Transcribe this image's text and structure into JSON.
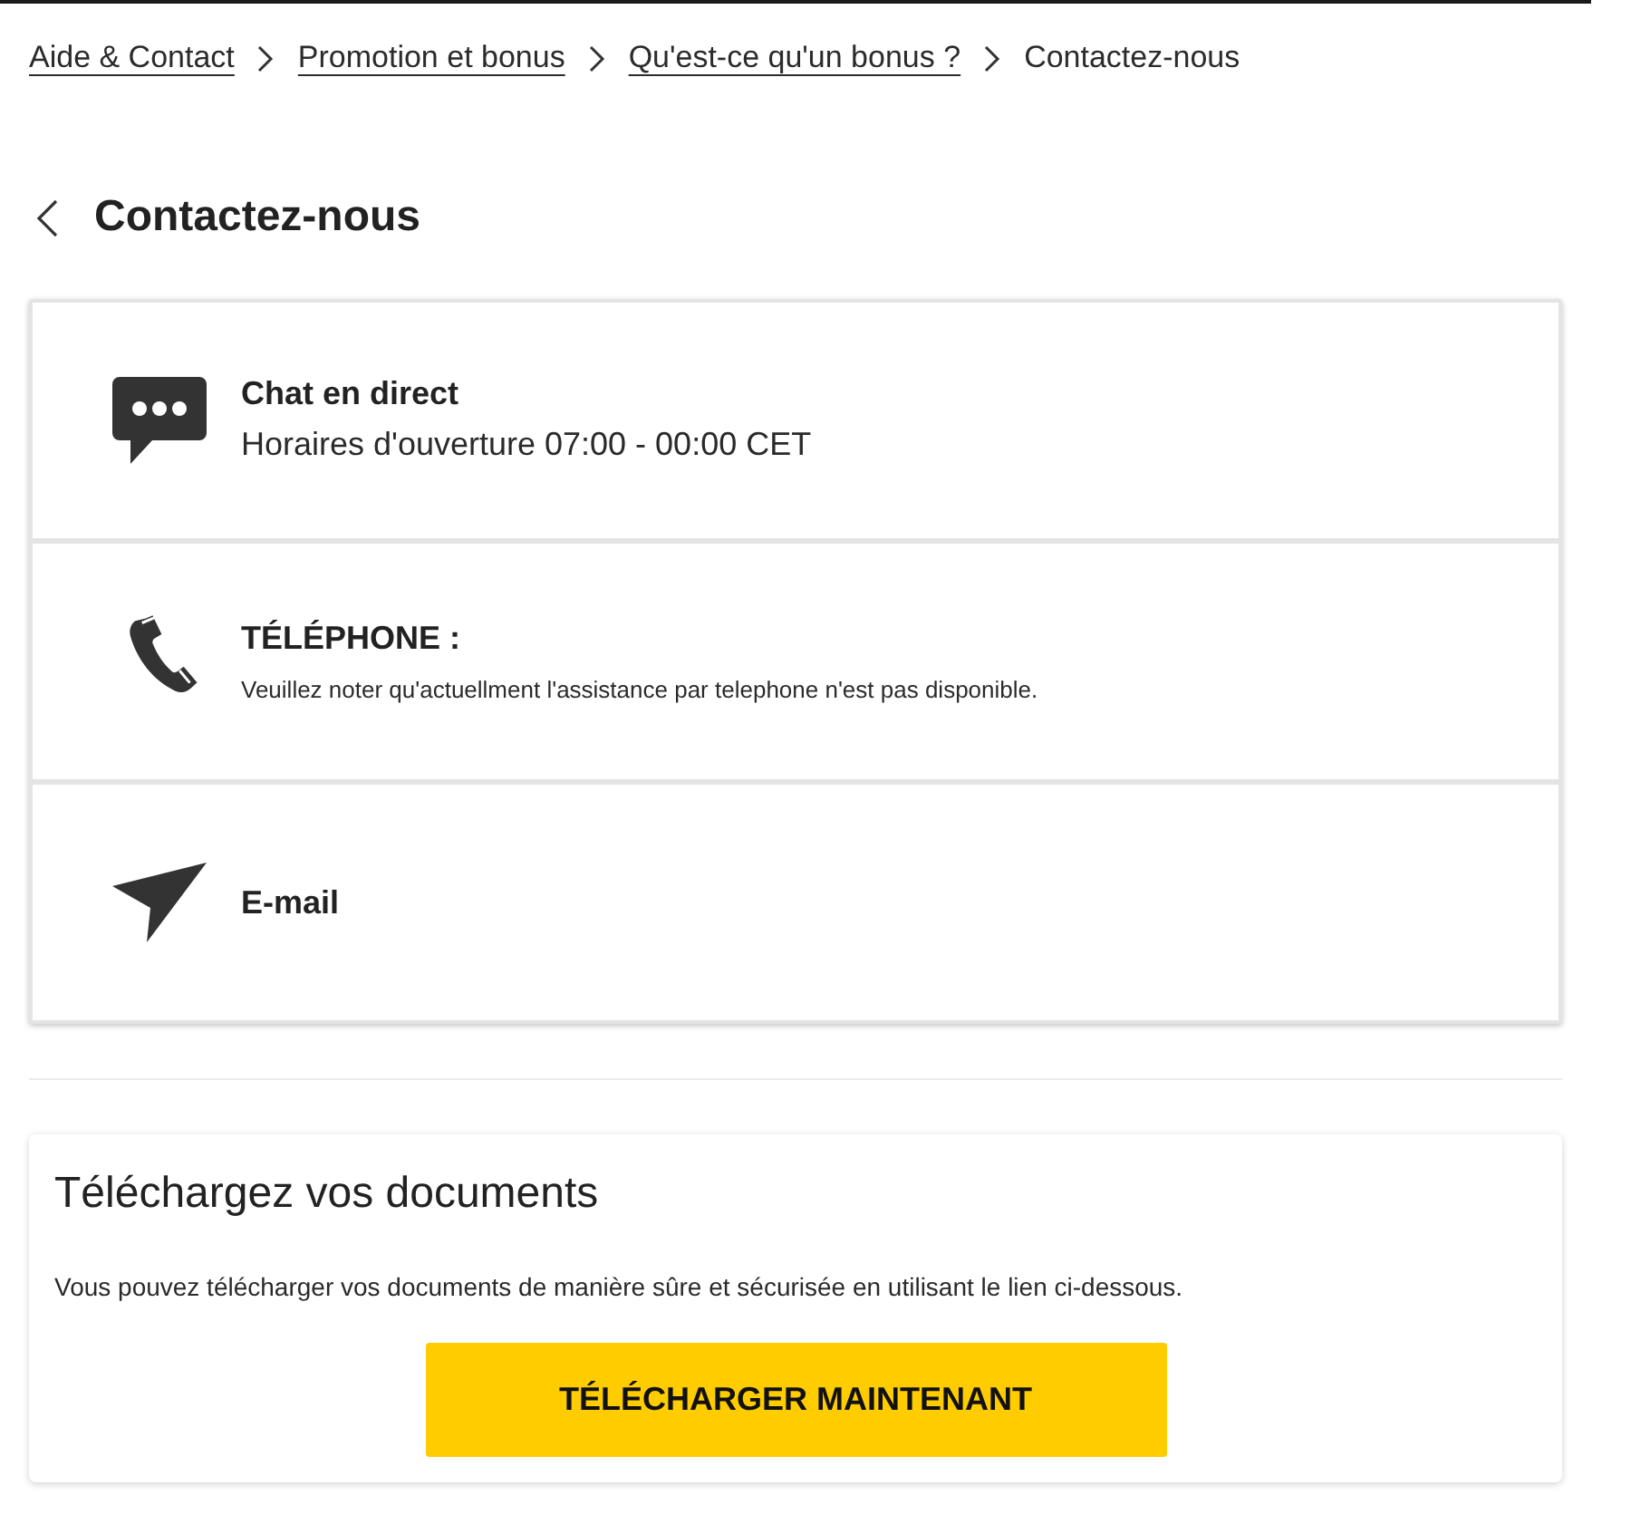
{
  "breadcrumb": [
    {
      "label": "Aide & Contact",
      "current": false
    },
    {
      "label": "Promotion et bonus",
      "current": false
    },
    {
      "label": "Qu'est-ce qu'un bonus ?",
      "current": false
    },
    {
      "label": "Contactez-nous",
      "current": true
    }
  ],
  "page_title": "Contactez-nous",
  "contact_options": [
    {
      "kind": "chat",
      "title": "Chat en direct",
      "detail": "Horaires d'ouverture 07:00 - 00:00 CET"
    },
    {
      "kind": "phone",
      "title": "TÉLÉPHONE :",
      "note": "Veuillez noter qu'actuellment l'assistance par telephone n'est pas disponible."
    },
    {
      "kind": "email",
      "title": "E-mail"
    }
  ],
  "upload": {
    "title": "Téléchargez vos documents",
    "text": "Vous pouvez télécharger vos documents de manière sûre et sécurisée en utilisant le lien ci-dessous.",
    "button": "TÉLÉCHARGER MAINTENANT"
  }
}
